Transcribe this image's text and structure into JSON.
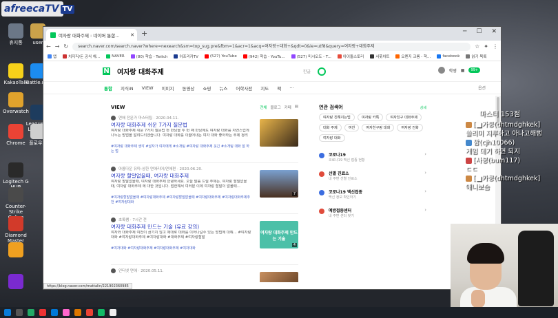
{
  "stream": {
    "brand": "afreecaTV",
    "brand_tv": "TV"
  },
  "desktop_icons": [
    "휴지통",
    "user",
    "KakaoTalk",
    "Battle.net",
    "Overwatch",
    "League of Legends",
    "Chrome",
    "플로우지",
    "Logitech G HUB",
    "Counter-Strike Online",
    "Diamond Master",
    "",
    ""
  ],
  "browser": {
    "tab_title": "여자랑 대화주제 : 네이버 통합...",
    "url": "search.naver.com/search.naver?where=nexearch&sm=top_sug.pre&fbm=1&acr=1&acq=여자랑+대화+&qdt=0&ie=utf8&query=여자랑+대화주제",
    "bookmarks": [
      "앱",
      "치지직/돈 공식 채...",
      "NAVER",
      "(80) 학습 - Twitch",
      "아프리카TV",
      "(527) YouTube",
      "(942) 학습 - YouTu...",
      "(527) 미시오도 - T...",
      "아이돌스토리",
      "서폿차트",
      "오렌지 크롬 - 학...",
      "facebook",
      "읽기 목록"
    ]
  },
  "naver": {
    "query": "여자랑 대화주제",
    "keyboard_hint": "한글",
    "user_label": "학생",
    "badge": "99+",
    "nav_tabs": [
      "통합",
      "지식iN",
      "VIEW",
      "이미지",
      "동영상",
      "쇼핑",
      "뉴스",
      "어학사전",
      "지도",
      "책",
      "···"
    ],
    "options": "옵션"
  },
  "view": {
    "heading": "VIEW",
    "sort": [
      "전체",
      "블로그",
      "카페"
    ],
    "results": [
      {
        "meta": "연애 전문가 마스터팁 · 2020.04.11.",
        "title": "여자랑 대화주제 쉬운 7가지 질문법",
        "desc": "여자랑 대화주제 쉬운 7가지 질문법 첫 만남을 두 번 째 만남에도 여자랑 대화를 자연스럽게 나누는 방법을 알려드리겠습니다. 여자랑 대화를 이끌어내는 여자 대화 좋아하는 주제 정리",
        "tags": "#여자랑 대화주제 생각 #남자가 여자에게 #소개팅 #여자랑 대화주제 웃긴 #소개팅 대화 잘 하는 법",
        "count": ""
      },
      {
        "meta": "아름다운 유마-삼한 연애리어/연애편 · 2020.06.20.",
        "title": "여자랑 할말없을때, 여자랑 대화주제",
        "desc": "여자랑 할말없을때, 여자랑 대화주제 안녕하세요. 오늘 말씀 드릴 주제는, 여자랑 할말없을 때, 여자랑 대화주제 에 대한 것입니다. 접한해서 여러분 이제 여자랑 할말이 없을때...",
        "tags": "#여자랑할말없을때  #여자랑대화주제  #여자랑할말없을때  #여자랑대화주제  #여자랑대화주제추천  #여자랑대화",
        "count": "7"
      },
      {
        "meta": "초록쌤 · 7시간 전",
        "title": "여자랑 대화주제 만드는 기술 (유료 강의)",
        "desc": "여자와 대화주제 여전이 끊기지 않고 제대로 대화를 이어나갈수 있는 방법에 대해... #여자랑대화 #여자랑대화주제 #여자랑대화 #대화주제 #여자랑할말",
        "tags": "#여자대화  #여자랑대화주제  #여자랑대화주제  #여자대화",
        "count": "4",
        "thumb_text": "여자랑 대화주제 만드는 기술"
      },
      {
        "meta": "인터넷 연애 · 2020.05.11.",
        "title": "",
        "desc": "",
        "tags": "",
        "count": ""
      }
    ]
  },
  "related": {
    "heading": "연관 검색어",
    "more": "상세",
    "items": [
      "여자랑 친해지는법",
      "여자랑 카톡",
      "여자친구 대화주제",
      "대화 주제",
      "여친",
      "여자친구랑 대화",
      "여자랑 전화",
      "여자랑 대화"
    ]
  },
  "side": [
    {
      "title": "코로나19",
      "sub": "코로나19 백신 접종 현황"
    },
    {
      "title": "선별 진료소",
      "sub": "내 주변 선별 진료소"
    },
    {
      "title": "코로나19 백신접종",
      "sub": "백신 정보 확인하기"
    },
    {
      "title": "예방접종센터",
      "sub": "내 주변 센터 찾기"
    }
  ],
  "status_url": "https://blog.naver.com/mattalin/221902360985",
  "chat": {
    "header": "마스터 153점",
    "lines": [
      "[■가쿵(dhtmdghkek]",
      "쓸리미 지루하고 아나고해뻥",
      "깜(cjh10066)",
      "게임 데기 하면 되지",
      "[사봉(bum117)",
      "ㄷㄷ",
      "[■카쿵(dhtmdghkek]",
      "애니보슴"
    ]
  },
  "colors": {
    "naver_green": "#03c75a",
    "link_blue": "#2a3bc0"
  }
}
